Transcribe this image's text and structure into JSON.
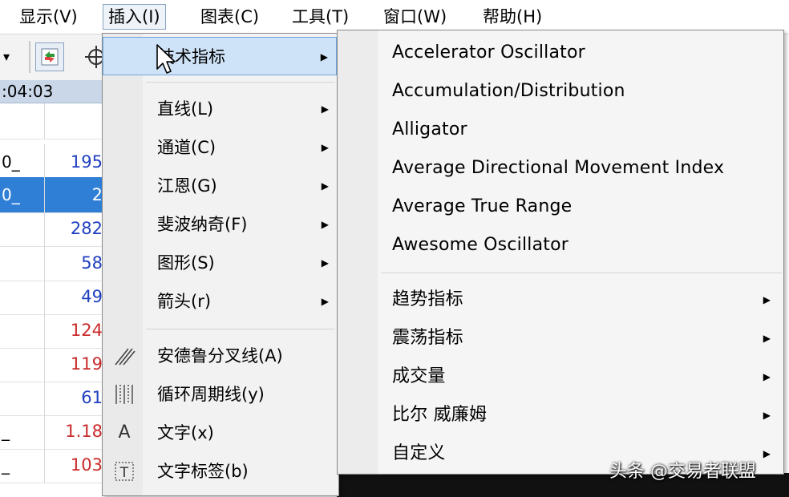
{
  "menubar": {
    "items": [
      {
        "label": "显示(V)"
      },
      {
        "label": "插入(I)"
      },
      {
        "label": "图表(C)"
      },
      {
        "label": "工具(T)"
      },
      {
        "label": "窗口(W)"
      },
      {
        "label": "帮助(H)"
      }
    ]
  },
  "timebar": {
    "time": ":04:03"
  },
  "table": {
    "rows": [
      {
        "c1": "",
        "c2": "",
        "color": ""
      },
      {
        "c1": "0_",
        "c2": "195",
        "color": "blue"
      },
      {
        "c1": "0_",
        "c2": "2",
        "color": "blue",
        "selected": true
      },
      {
        "c1": "",
        "c2": "282",
        "color": "blue"
      },
      {
        "c1": "",
        "c2": "58",
        "color": "blue"
      },
      {
        "c1": "",
        "c2": "49",
        "color": "blue"
      },
      {
        "c1": "",
        "c2": "124",
        "color": "red"
      },
      {
        "c1": "",
        "c2": "119",
        "color": "red"
      },
      {
        "c1": "",
        "c2": "61",
        "color": "blue"
      },
      {
        "c1": "_",
        "c2": "1.18",
        "color": "red"
      },
      {
        "c1": "_",
        "c2": "103",
        "color": "red"
      }
    ]
  },
  "insert_menu": {
    "items": [
      {
        "label": "技术指标",
        "submenu": true,
        "highlighted": true
      },
      {
        "label": "直线(L)",
        "submenu": true
      },
      {
        "label": "通道(C)",
        "submenu": true
      },
      {
        "label": "江恩(G)",
        "submenu": true
      },
      {
        "label": "斐波纳奇(F)",
        "submenu": true
      },
      {
        "label": "图形(S)",
        "submenu": true
      },
      {
        "label": "箭头(r)",
        "submenu": true
      },
      {
        "label": "安德鲁分叉线(A)",
        "icon": "andrews-pitchfork-icon"
      },
      {
        "label": "循环周期线(y)",
        "icon": "cycle-lines-icon"
      },
      {
        "label": "文字(x)",
        "icon": "text-icon"
      },
      {
        "label": "文字标签(b)",
        "icon": "text-label-icon"
      }
    ]
  },
  "indicator_submenu": {
    "items": [
      {
        "label": "Accelerator Oscillator"
      },
      {
        "label": "Accumulation/Distribution"
      },
      {
        "label": "Alligator"
      },
      {
        "label": "Average Directional Movement Index"
      },
      {
        "label": "Average True Range"
      },
      {
        "label": "Awesome Oscillator"
      }
    ],
    "groups": [
      {
        "label": "趋势指标"
      },
      {
        "label": "震荡指标"
      },
      {
        "label": "成交量"
      },
      {
        "label": "比尔 威廉姆"
      },
      {
        "label": "自定义"
      }
    ]
  },
  "watermark": "头条 @交易者联盟",
  "colors": {
    "highlight": "#cfe3f8",
    "selection": "#2f7fd6",
    "positive": "#1f3fbf",
    "negative": "#c92b2b"
  }
}
